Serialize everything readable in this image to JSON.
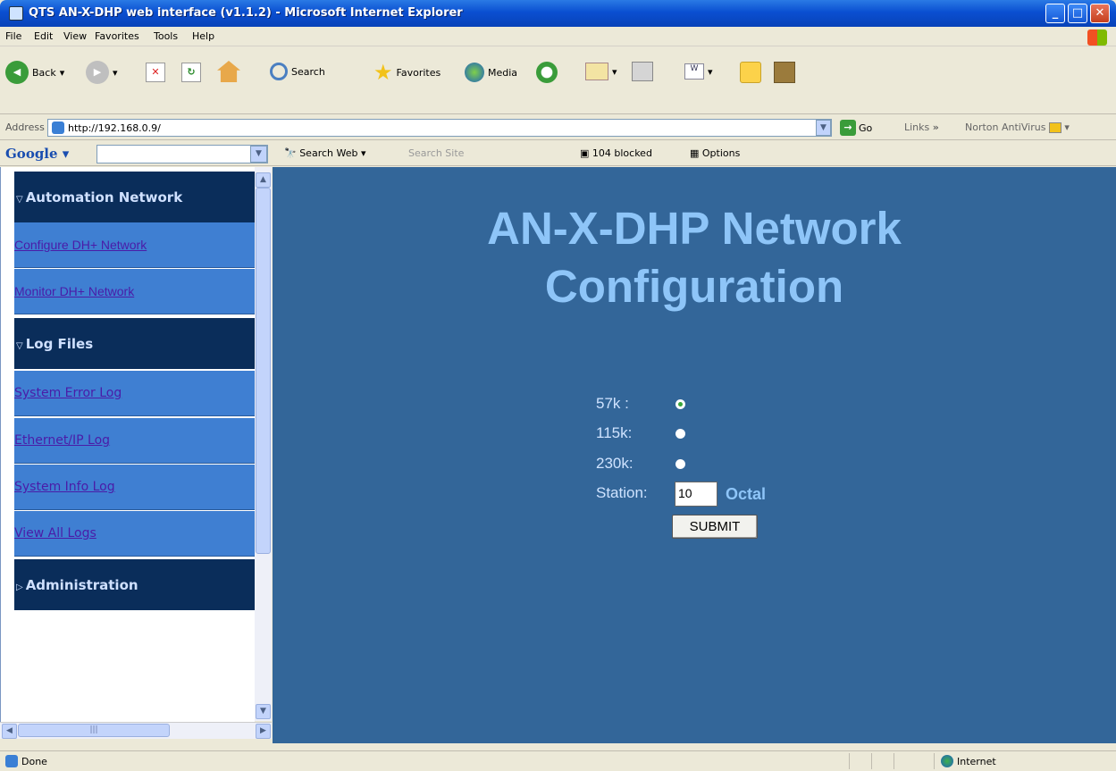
{
  "window": {
    "title": "QTS AN-X-DHP web interface (v1.1.2) - Microsoft Internet Explorer"
  },
  "menu": [
    "File",
    "Edit",
    "View",
    "Favorites",
    "Tools",
    "Help"
  ],
  "toolbar": {
    "back": "Back",
    "search": "Search",
    "favorites": "Favorites",
    "media": "Media"
  },
  "address": {
    "label": "Address",
    "url": "http://192.168.0.9/",
    "go": "Go",
    "links": "Links",
    "links_chevron": "»",
    "norton": "Norton AntiVirus"
  },
  "google": {
    "logo": "Google",
    "search_web": "Search Web",
    "search_site": "Search Site",
    "blocked": "104 blocked",
    "options": "Options"
  },
  "sidebar": {
    "sections": [
      {
        "label": "Automation Network",
        "expanded": true
      },
      {
        "label": "Log Files",
        "expanded": true
      },
      {
        "label": "Administration",
        "expanded": false
      }
    ],
    "links": [
      "Configure DH+ Network",
      "Monitor DH+ Network",
      "System Error Log",
      "Ethernet/IP Log",
      "System Info Log",
      "View All Logs"
    ]
  },
  "main": {
    "heading_line1": "AN-X-DHP Network",
    "heading_line2": "Configuration",
    "options": [
      {
        "label": "57k :",
        "selected": true
      },
      {
        "label": "115k:",
        "selected": false
      },
      {
        "label": "230k:",
        "selected": false
      }
    ],
    "station_label": "Station:",
    "station_value": "10",
    "station_unit": "Octal",
    "submit": "SUBMIT"
  },
  "status": {
    "text": "Done",
    "zone": "Internet"
  },
  "colors": {
    "page_bg": "#336699",
    "heading": "#8ec5f8",
    "nav_section": "#0a2d5a",
    "nav_link_bg": "#3f7fd2"
  }
}
